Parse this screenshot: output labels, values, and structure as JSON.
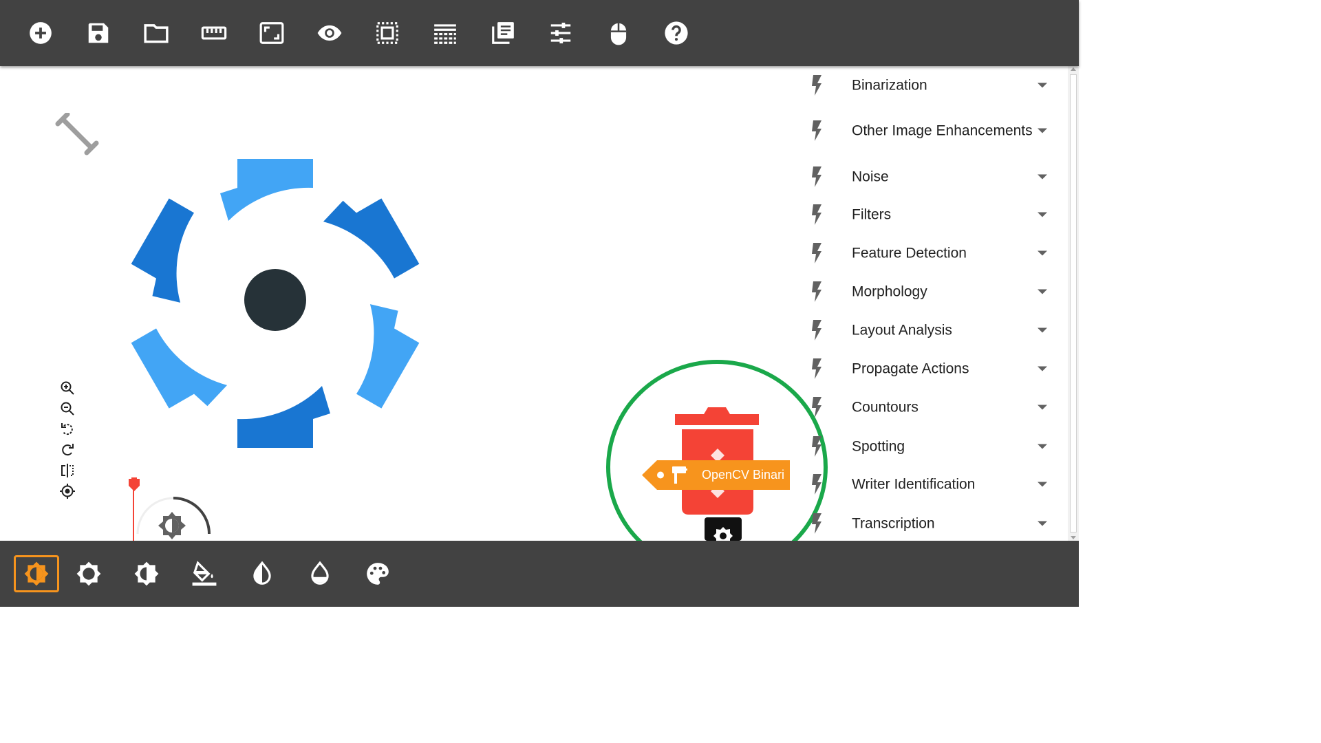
{
  "toolbar": {
    "buttons": [
      {
        "icon": "add-circle-icon"
      },
      {
        "icon": "save-icon"
      },
      {
        "icon": "folder-icon"
      },
      {
        "icon": "ruler-icon"
      },
      {
        "icon": "fit-screen-icon"
      },
      {
        "icon": "eye-icon"
      },
      {
        "icon": "select-area-icon"
      },
      {
        "icon": "text-lines-icon"
      },
      {
        "icon": "library-books-icon"
      },
      {
        "icon": "tune-icon"
      },
      {
        "icon": "mouse-icon"
      },
      {
        "icon": "help-icon"
      }
    ]
  },
  "categories": [
    {
      "label": "Binarization"
    },
    {
      "label": "Other Image Enhancements"
    },
    {
      "label": "Noise"
    },
    {
      "label": "Filters"
    },
    {
      "label": "Feature Detection"
    },
    {
      "label": "Morphology"
    },
    {
      "label": "Layout Analysis"
    },
    {
      "label": "Propagate Actions"
    },
    {
      "label": "Countours"
    },
    {
      "label": "Spotting"
    },
    {
      "label": "Writer Identification"
    },
    {
      "label": "Transcription"
    }
  ],
  "workspace": {
    "block_label": "OpenCV Binari",
    "zoom_controls": [
      "zoom-in-icon",
      "zoom-out-icon",
      "rotate-left-icon",
      "rotate-right-icon",
      "flip-icon",
      "center-icon"
    ]
  },
  "bottom_bar": {
    "active_index": 0,
    "buttons": [
      {
        "icon": "brightness-contrast-icon"
      },
      {
        "icon": "brightness-icon"
      },
      {
        "icon": "contrast-icon"
      },
      {
        "icon": "fill-color-icon"
      },
      {
        "icon": "invert-icon"
      },
      {
        "icon": "tint-drop-icon"
      },
      {
        "icon": "palette-icon"
      }
    ]
  },
  "colors": {
    "bar_bg": "#424242",
    "accent": "#f7941d",
    "trash_red": "#f44336",
    "highlight_green": "#1aa84a",
    "logo_light_blue": "#42a5f5",
    "logo_dark_blue": "#1976d2"
  }
}
